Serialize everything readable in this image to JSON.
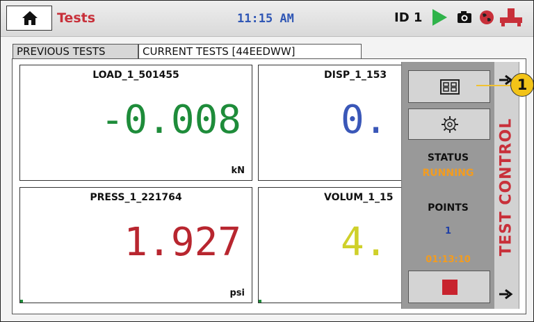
{
  "header": {
    "title": "Tests",
    "time": "11:15 AM",
    "id_label": "ID 1",
    "icons": [
      "home-icon",
      "play-icon",
      "camera-icon",
      "globe-icon",
      "plug-icon"
    ]
  },
  "tabs": [
    {
      "label": "PREVIOUS TESTS",
      "active": false
    },
    {
      "label": "CURRENT TESTS [44EEDWW]",
      "active": true
    }
  ],
  "panels": [
    {
      "label": "LOAD_1_501455",
      "value": "-0.008",
      "unit": "kN",
      "color": "#1e8c3a"
    },
    {
      "label": "DISP_1_153",
      "value": "0.",
      "unit": "",
      "color": "#3a57b8"
    },
    {
      "label": "PRESS_1_221764",
      "value": "1.927",
      "unit": "psi",
      "color": "#b8262f"
    },
    {
      "label": "VOLUM_1_15",
      "value": "4.",
      "unit": "",
      "color": "#cfd02a"
    }
  ],
  "test_control": {
    "tab_label": "TEST CONTROL",
    "status_label": "STATUS",
    "status_value": "RUNNING",
    "points_label": "POINTS",
    "points_value": "1",
    "elapsed": "01:13:10",
    "buttons": [
      "layout-grid-icon",
      "gear-icon",
      "stop-icon"
    ]
  },
  "callout": {
    "number": "1"
  },
  "colors": {
    "accent_red": "#c8303a",
    "clock_blue": "#3057b5",
    "running_orange": "#f39c1f",
    "points_blue": "#1f3fa6",
    "callout_yellow": "#f2c318"
  }
}
